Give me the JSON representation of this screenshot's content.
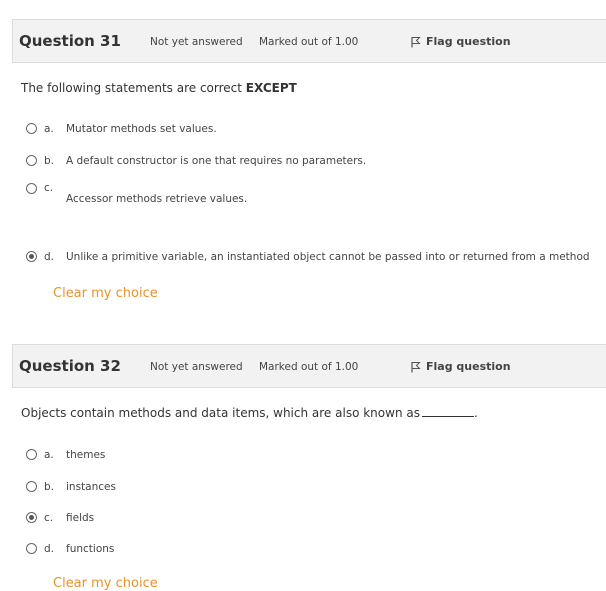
{
  "q31": {
    "number_label": "Question 31",
    "state": "Not yet answered",
    "grade": "Marked out of 1.00",
    "flag_label": "Flag question",
    "text_prefix": "The following statements are correct ",
    "text_bold": "EXCEPT",
    "options": [
      {
        "letter": "a.",
        "text": "Mutator methods set values.",
        "checked": false
      },
      {
        "letter": "b.",
        "text": "A default constructor is one that requires no parameters.",
        "checked": false
      },
      {
        "letter": "c.",
        "text": "Accessor methods retrieve values.",
        "checked": false
      },
      {
        "letter": "d.",
        "text": "Unlike a primitive variable, an instantiated object cannot be passed into or returned from a method",
        "checked": true
      }
    ],
    "clear_label": "Clear my choice"
  },
  "q32": {
    "number_label": "Question 32",
    "state": "Not yet answered",
    "grade": "Marked out of 1.00",
    "flag_label": "Flag question",
    "text": "Objects contain methods and data items, which are also known as",
    "text_end": ".",
    "options": [
      {
        "letter": "a.",
        "text": "themes",
        "checked": false
      },
      {
        "letter": "b.",
        "text": "instances",
        "checked": false
      },
      {
        "letter": "c.",
        "text": "fields",
        "checked": true
      },
      {
        "letter": "d.",
        "text": "functions",
        "checked": false
      }
    ],
    "clear_label": "Clear my choice"
  }
}
